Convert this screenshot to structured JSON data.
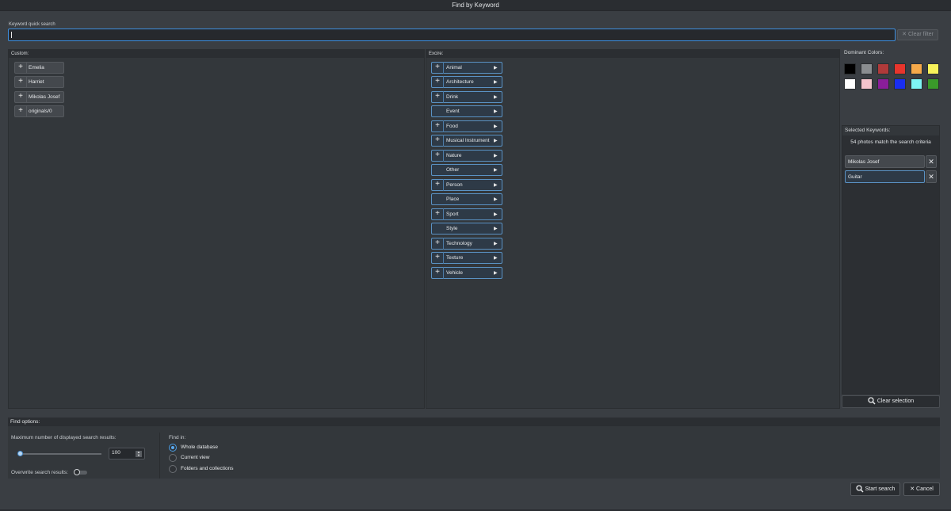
{
  "window": {
    "title": "Find by Keyword"
  },
  "quick_search": {
    "label": "Keyword quick search",
    "value": "",
    "clear_filter_label": "Clear filter"
  },
  "custom": {
    "label": "Custom:",
    "items": [
      {
        "label": "Emelia"
      },
      {
        "label": "Harriet"
      },
      {
        "label": "Mikolas Josef"
      },
      {
        "label": "originals/0"
      }
    ]
  },
  "excire": {
    "label": "Excire:",
    "items": [
      {
        "label": "Animal",
        "expandable": true
      },
      {
        "label": "Architecture",
        "expandable": true
      },
      {
        "label": "Drink",
        "expandable": true
      },
      {
        "label": "Event",
        "expandable": false
      },
      {
        "label": "Food",
        "expandable": true
      },
      {
        "label": "Musical Instrument",
        "expandable": true
      },
      {
        "label": "Nature",
        "expandable": true
      },
      {
        "label": "Other",
        "expandable": false
      },
      {
        "label": "Person",
        "expandable": true
      },
      {
        "label": "Place",
        "expandable": false
      },
      {
        "label": "Sport",
        "expandable": true
      },
      {
        "label": "Style",
        "expandable": false
      },
      {
        "label": "Technology",
        "expandable": true
      },
      {
        "label": "Texture",
        "expandable": true
      },
      {
        "label": "Vehicle",
        "expandable": true
      }
    ]
  },
  "dominant_colors": {
    "label": "Dominant Colors:",
    "swatches": [
      "#000000",
      "#8a8d90",
      "#b03a3a",
      "#e8352c",
      "#f5a94a",
      "#f7f25a",
      "#ffffff",
      "#f4c4cc",
      "#8a1e9a",
      "#1a2ef0",
      "#7ef4f4",
      "#3a9a2a"
    ]
  },
  "selected_keywords": {
    "label": "Selected Keywords:",
    "match_text": "54 photos match the search criteria",
    "items": [
      {
        "label": "Mikolas Josef",
        "style": "custom"
      },
      {
        "label": "Guitar",
        "style": "excire"
      }
    ],
    "clear_label": "Clear selection"
  },
  "find_options": {
    "label": "Find options:",
    "max_results_label": "Maximum number of displayed search results:",
    "max_results_value": "100",
    "slider_level": 0.0,
    "overwrite_label": "Overwrite search results:",
    "overwrite_on": false,
    "find_in_label": "Find in:",
    "find_in_options": [
      {
        "label": "Whole database",
        "selected": true
      },
      {
        "label": "Current view",
        "selected": false
      },
      {
        "label": "Folders and collections",
        "selected": false
      }
    ]
  },
  "buttons": {
    "start": "Start search",
    "cancel": "Cancel"
  }
}
